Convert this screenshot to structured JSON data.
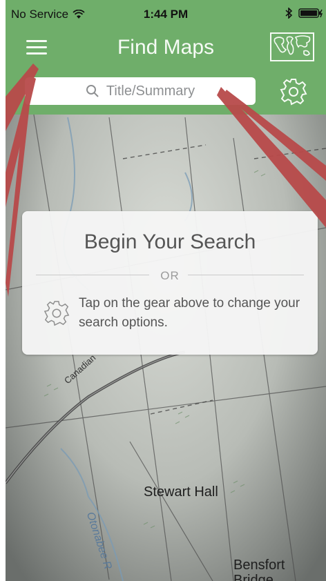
{
  "status_bar": {
    "carrier": "No Service",
    "time": "1:44 PM"
  },
  "nav": {
    "title": "Find Maps",
    "menu_icon": "hamburger-menu-icon",
    "world_icon": "world-map-icon"
  },
  "search": {
    "placeholder": "Title/Summary",
    "gear_icon": "gear-icon"
  },
  "card": {
    "heading": "Begin Your Search",
    "or": "OR",
    "hint": "Tap on the gear above to change your search options."
  },
  "map_labels": {
    "stewart_hall": "Stewart Hall",
    "bensfort": "Bensfort",
    "bridge": "Bridge",
    "canadian": "Canadian",
    "otonabee": "Otonabee R"
  },
  "colors": {
    "header_green": "#6fae6a",
    "annotation_red": "#b84a4a"
  }
}
